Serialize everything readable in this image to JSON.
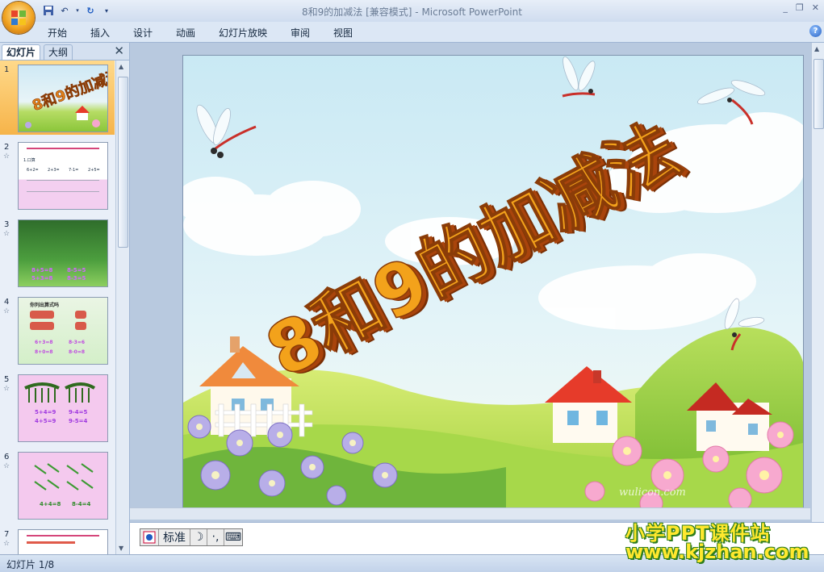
{
  "window": {
    "title": "8和9的加减法 [兼容模式] - Microsoft PowerPoint",
    "controls": [
      "_",
      "❐",
      "✕"
    ]
  },
  "ribbon": {
    "tabs": [
      "开始",
      "插入",
      "设计",
      "动画",
      "幻灯片放映",
      "审阅",
      "视图"
    ],
    "help": "?"
  },
  "panel": {
    "tab_slides": "幻灯片",
    "tab_outline": "大纲",
    "close": "✕",
    "thumbnails": [
      {
        "num": "1",
        "selected": true
      },
      {
        "num": "2",
        "text": [
          "1.口算",
          "6+2=",
          "2+3=",
          "7-1=",
          "2+5="
        ],
        "star": "☆"
      },
      {
        "num": "3",
        "text": [
          "8+5=8",
          "8-5=5",
          "5+3=8",
          "8-3=5"
        ],
        "star": "☆"
      },
      {
        "num": "4",
        "text": [
          "你列出算式吗",
          "6+3=8",
          "8-3=6",
          "8+0=8",
          "8-0=8"
        ],
        "star": "☆"
      },
      {
        "num": "5",
        "text": [
          "5+4=9",
          "9-4=5",
          "4+5=9",
          "9-5=4"
        ],
        "star": "☆"
      },
      {
        "num": "6",
        "text": [
          "4+4=8",
          "8-4=4"
        ],
        "star": "☆"
      },
      {
        "num": "7",
        "text": [
          "",
          ""
        ],
        "star": "☆"
      }
    ]
  },
  "slide": {
    "title": "8和9的加减法",
    "credit": "wulicon.com"
  },
  "ime": {
    "mode": "标准"
  },
  "status": {
    "slide_counter": "幻灯片 1/8"
  },
  "watermark": {
    "line1": "小学PPT课件站",
    "line2": "www.kjzhan.com"
  },
  "colors": {
    "accent": "#f6b44a",
    "ribbon": "#dce7f5",
    "title_text": "#f3a21b"
  }
}
